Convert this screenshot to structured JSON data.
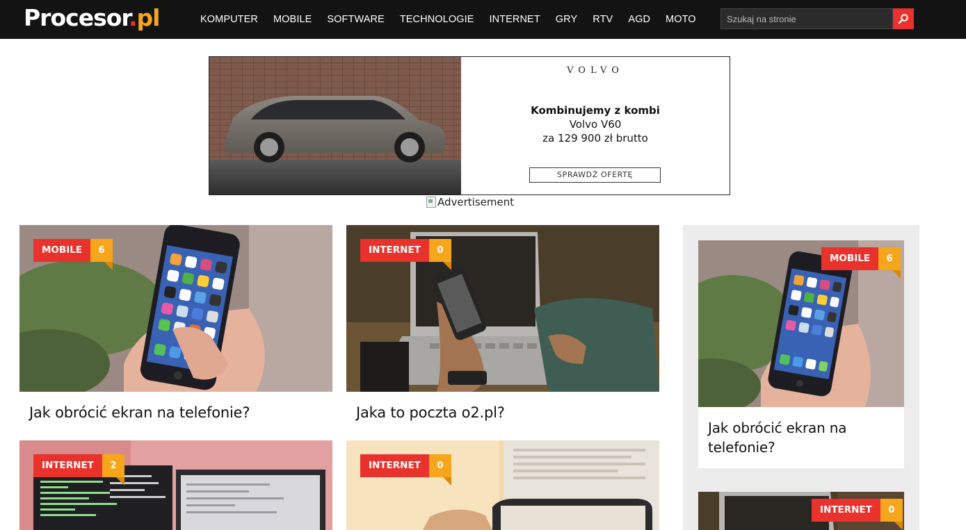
{
  "header": {
    "logo_main": "Procesor",
    "logo_dot": ".",
    "logo_tld": "pl",
    "nav": [
      "KOMPUTER",
      "MOBILE",
      "SOFTWARE",
      "TECHNOLOGIE",
      "INTERNET",
      "GRY",
      "RTV",
      "AGD",
      "MOTO"
    ],
    "search_placeholder": "Szukaj na stronie",
    "search_icon": "search-icon"
  },
  "ad": {
    "brand": "VOLVO",
    "headline": "Kombinujemy z kombi",
    "line1": "Volvo V60",
    "line2": "za 129 900 zł brutto",
    "cta": "SPRAWDŹ OFERTĘ",
    "alt_text": "Advertisement"
  },
  "cards": [
    {
      "category": "MOBILE",
      "count": "6",
      "title": "Jak obrócić ekran na telefonie?"
    },
    {
      "category": "INTERNET",
      "count": "0",
      "title": "Jaka to poczta o2.pl?"
    },
    {
      "category": "INTERNET",
      "count": "2",
      "title": ""
    },
    {
      "category": "INTERNET",
      "count": "0",
      "title": ""
    }
  ],
  "sidebar": {
    "cards": [
      {
        "category": "MOBILE",
        "count": "6",
        "title_line1": "Jak obrócić ekran na",
        "title_line2": "telefonie?"
      },
      {
        "category": "INTERNET",
        "count": "0"
      }
    ]
  },
  "colors": {
    "header_bg": "#131313",
    "accent_red": "#e8322b",
    "accent_orange": "#f7a61c",
    "sidebar_bg": "#ececec"
  }
}
